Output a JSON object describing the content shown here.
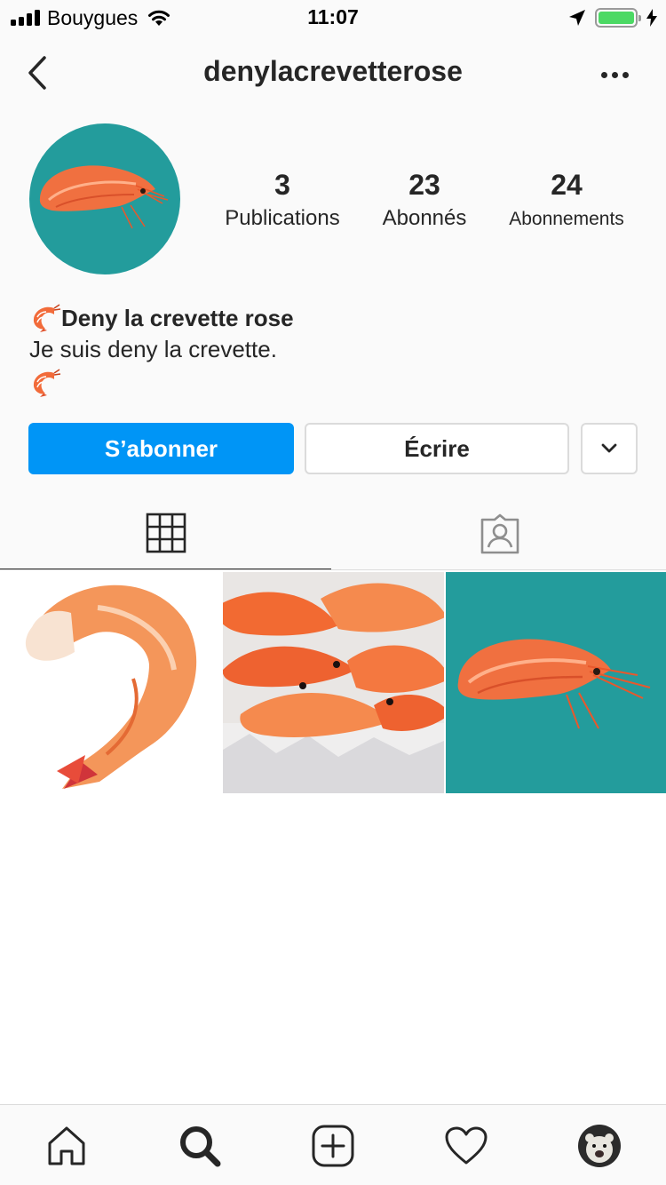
{
  "status_bar": {
    "carrier": "Bouygues",
    "time": "11:07",
    "battery_level": 1.0,
    "battery_color": "#4cd964"
  },
  "header": {
    "username": "denylacrevetterose",
    "back_icon": "chevron-left-icon",
    "more_icon": "more-horizontal-icon"
  },
  "profile": {
    "avatar_background": "#239c9c",
    "stats": {
      "posts_count": "3",
      "posts_label": "Publications",
      "followers_count": "23",
      "followers_label": "Abonnés",
      "following_count": "24",
      "following_label": "Abonnements"
    },
    "bio": {
      "name": "Deny la crevette rose",
      "text": "Je suis deny la crevette.",
      "emoji": "shrimp-emoji"
    }
  },
  "actions": {
    "follow_label": "S’abonner",
    "message_label": "Écrire",
    "suggest_icon": "chevron-down-icon",
    "accent": "#0095f6"
  },
  "tabs": {
    "grid_icon": "grid-icon",
    "tagged_icon": "tagged-user-icon",
    "active": "grid"
  },
  "posts": [
    {
      "subject": "shrimp-white-background"
    },
    {
      "subject": "shrimp-on-ice"
    },
    {
      "subject": "shrimp-teal-background"
    }
  ],
  "bottom_nav": {
    "items": [
      "home-icon",
      "search-icon",
      "add-post-icon",
      "heart-icon",
      "profile-avatar"
    ]
  }
}
